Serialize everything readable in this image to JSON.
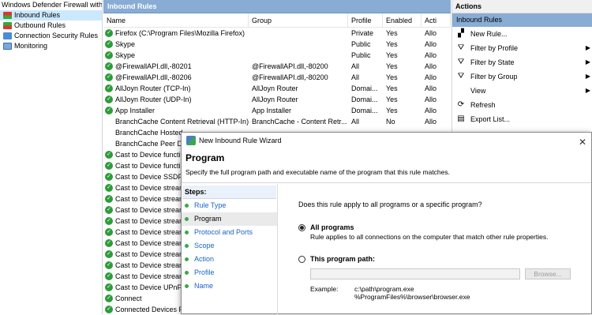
{
  "tree": {
    "root_label": "Windows Defender Firewall with",
    "items": [
      {
        "label": "Inbound Rules",
        "selected": true
      },
      {
        "label": "Outbound Rules",
        "selected": false
      },
      {
        "label": "Connection Security Rules",
        "selected": false
      },
      {
        "label": "Monitoring",
        "selected": false
      }
    ]
  },
  "rules": {
    "header": "Inbound Rules",
    "columns": [
      "Name",
      "Group",
      "Profile",
      "Enabled",
      "Acti"
    ],
    "rows": [
      {
        "name": "Firefox (C:\\Program Files\\Mozilla Firefox)",
        "group": "",
        "profile": "Private",
        "enabled": "Yes",
        "action": "Allo",
        "check": true
      },
      {
        "name": "Skype",
        "group": "",
        "profile": "Public",
        "enabled": "Yes",
        "action": "Allo",
        "check": true
      },
      {
        "name": "Skype",
        "group": "",
        "profile": "Public",
        "enabled": "Yes",
        "action": "Allo",
        "check": true
      },
      {
        "name": "@FirewallAPI.dll,-80201",
        "group": "@FirewallAPI.dll,-80200",
        "profile": "All",
        "enabled": "Yes",
        "action": "Allo",
        "check": true
      },
      {
        "name": "@FirewallAPI.dll,-80206",
        "group": "@FirewallAPI.dll,-80200",
        "profile": "All",
        "enabled": "Yes",
        "action": "Allo",
        "check": true
      },
      {
        "name": "AllJoyn Router (TCP-In)",
        "group": "AllJoyn Router",
        "profile": "Domai...",
        "enabled": "Yes",
        "action": "Allo",
        "check": true
      },
      {
        "name": "AllJoyn Router (UDP-In)",
        "group": "AllJoyn Router",
        "profile": "Domai...",
        "enabled": "Yes",
        "action": "Allo",
        "check": true
      },
      {
        "name": "App Installer",
        "group": "App Installer",
        "profile": "Domai...",
        "enabled": "Yes",
        "action": "Allo",
        "check": true
      },
      {
        "name": "BranchCache Content Retrieval (HTTP-In)",
        "group": "BranchCache - Content Retr...",
        "profile": "All",
        "enabled": "No",
        "action": "Allo",
        "check": false
      },
      {
        "name": "BranchCache Hosted",
        "group": "",
        "profile": "",
        "enabled": "",
        "action": "",
        "check": false
      },
      {
        "name": "BranchCache Peer Di",
        "group": "",
        "profile": "",
        "enabled": "",
        "action": "",
        "check": false
      },
      {
        "name": "Cast to Device functi",
        "group": "",
        "profile": "",
        "enabled": "",
        "action": "",
        "check": true
      },
      {
        "name": "Cast to Device functi",
        "group": "",
        "profile": "",
        "enabled": "",
        "action": "",
        "check": true
      },
      {
        "name": "Cast to Device SSDP",
        "group": "",
        "profile": "",
        "enabled": "",
        "action": "",
        "check": true
      },
      {
        "name": "Cast to Device strear",
        "group": "",
        "profile": "",
        "enabled": "",
        "action": "",
        "check": true
      },
      {
        "name": "Cast to Device strear",
        "group": "",
        "profile": "",
        "enabled": "",
        "action": "",
        "check": true
      },
      {
        "name": "Cast to Device strear",
        "group": "",
        "profile": "",
        "enabled": "",
        "action": "",
        "check": true
      },
      {
        "name": "Cast to Device strear",
        "group": "",
        "profile": "",
        "enabled": "",
        "action": "",
        "check": true
      },
      {
        "name": "Cast to Device strear",
        "group": "",
        "profile": "",
        "enabled": "",
        "action": "",
        "check": true
      },
      {
        "name": "Cast to Device strear",
        "group": "",
        "profile": "",
        "enabled": "",
        "action": "",
        "check": true
      },
      {
        "name": "Cast to Device strear",
        "group": "",
        "profile": "",
        "enabled": "",
        "action": "",
        "check": true
      },
      {
        "name": "Cast to Device strear",
        "group": "",
        "profile": "",
        "enabled": "",
        "action": "",
        "check": true
      },
      {
        "name": "Cast to Device strear",
        "group": "",
        "profile": "",
        "enabled": "",
        "action": "",
        "check": true
      },
      {
        "name": "Cast to Device UPnP",
        "group": "",
        "profile": "",
        "enabled": "",
        "action": "",
        "check": true
      },
      {
        "name": "Connect",
        "group": "",
        "profile": "",
        "enabled": "",
        "action": "",
        "check": true
      },
      {
        "name": "Connected Devices P",
        "group": "",
        "profile": "",
        "enabled": "",
        "action": "",
        "check": true
      }
    ]
  },
  "actions": {
    "title": "Actions",
    "section": "Inbound Rules",
    "items": [
      {
        "label": "New Rule...",
        "icon": "new-rule-icon",
        "glyph": "▞",
        "submenu": false
      },
      {
        "label": "Filter by Profile",
        "icon": "filter-icon",
        "glyph": "⛛",
        "submenu": true
      },
      {
        "label": "Filter by State",
        "icon": "filter-icon",
        "glyph": "⛛",
        "submenu": true
      },
      {
        "label": "Filter by Group",
        "icon": "filter-icon",
        "glyph": "⛛",
        "submenu": true
      },
      {
        "label": "View",
        "icon": "view-icon",
        "glyph": "",
        "submenu": true
      },
      {
        "label": "Refresh",
        "icon": "refresh-icon",
        "glyph": "⟳",
        "submenu": false
      },
      {
        "label": "Export List...",
        "icon": "export-icon",
        "glyph": "▤",
        "submenu": false
      }
    ]
  },
  "wizard": {
    "title": "New Inbound Rule Wizard",
    "heading": "Program",
    "description": "Specify the full program path and executable name of the program that this rule matches.",
    "steps_header": "Steps:",
    "steps": [
      {
        "label": "Rule Type",
        "current": false
      },
      {
        "label": "Program",
        "current": true
      },
      {
        "label": "Protocol and Ports",
        "current": false
      },
      {
        "label": "Scope",
        "current": false
      },
      {
        "label": "Action",
        "current": false
      },
      {
        "label": "Profile",
        "current": false
      },
      {
        "label": "Name",
        "current": false
      }
    ],
    "question": "Does this rule apply to all programs or a specific program?",
    "option_all_label": "All programs",
    "option_all_desc": "Rule applies to all connections on the computer that match other rule properties.",
    "option_path_label": "This program path:",
    "path_value": "",
    "browse_label": "Browse...",
    "example_label": "Example:",
    "example_lines": [
      "c:\\path\\program.exe",
      "%ProgramFiles%\\browser\\browser.exe"
    ],
    "selected_option": "all"
  }
}
